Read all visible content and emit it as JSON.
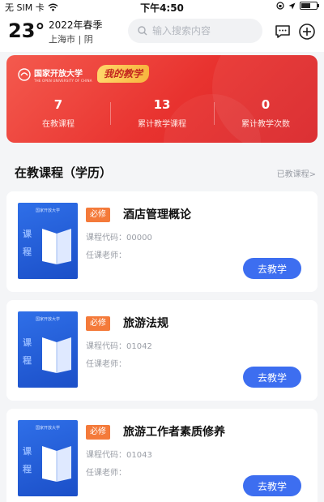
{
  "status_bar": {
    "carrier": "无 SIM 卡",
    "time": "下午4:50"
  },
  "header": {
    "temperature": "23°",
    "term": "2022年春季",
    "city_weather": "上海市 | 阴",
    "search_placeholder": "输入搜索内容",
    "icons": [
      "chat-icon",
      "add-circle-icon"
    ]
  },
  "banner": {
    "university_name": "国家开放大学",
    "university_subtitle": "THE OPEN UNIVERSITY OF CHINA",
    "tag": "我的教学",
    "stats": [
      {
        "value": "7",
        "label": "在教课程"
      },
      {
        "value": "13",
        "label": "累计教学课程"
      },
      {
        "value": "0",
        "label": "累计教学次数"
      }
    ],
    "colors": {
      "start": "#f45a4e",
      "end": "#d92428",
      "tag": "#f7b53e"
    }
  },
  "section": {
    "title": "在教课程（学历）",
    "link": "已教课程>"
  },
  "courses": [
    {
      "badge": "必修",
      "name": "酒店管理概论",
      "code": "课程代码：00000",
      "teacher": "任课老师：",
      "button": "去教学",
      "cover_uni": "国家开放大学",
      "cover_chars": [
        "课",
        "程"
      ]
    },
    {
      "badge": "必修",
      "name": "旅游法规",
      "code": "课程代码：01042",
      "teacher": "任课老师：",
      "button": "去教学",
      "cover_uni": "国家开放大学",
      "cover_chars": [
        "课",
        "程"
      ]
    },
    {
      "badge": "必修",
      "name": "旅游工作者素质修养",
      "code": "课程代码：01043",
      "teacher": "任课老师：",
      "button": "去教学",
      "cover_uni": "国家开放大学",
      "cover_chars": [
        "课",
        "程"
      ]
    }
  ],
  "colors": {
    "accent_blue": "#3d6ef0",
    "badge_orange": "#f47a3a"
  }
}
